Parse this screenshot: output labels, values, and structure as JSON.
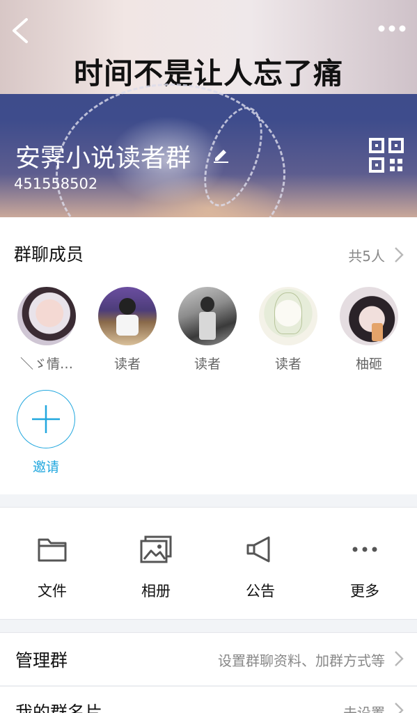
{
  "header": {
    "banner_text": "时间不是让人忘了痛",
    "group_name": "安霁小说读者群",
    "group_id": "451558502"
  },
  "members": {
    "title": "群聊成员",
    "count": "共5人",
    "list": [
      {
        "name": "＼ゞ情…"
      },
      {
        "name": "读者"
      },
      {
        "name": "读者"
      },
      {
        "name": "读者"
      },
      {
        "name": "柚砸"
      }
    ],
    "invite_label": "邀请"
  },
  "actions": [
    {
      "label": "文件",
      "icon": "folder-icon"
    },
    {
      "label": "相册",
      "icon": "album-icon"
    },
    {
      "label": "公告",
      "icon": "megaphone-icon"
    },
    {
      "label": "更多",
      "icon": "more-dots-icon"
    }
  ],
  "settings": [
    {
      "title": "管理群",
      "value": "设置群聊资料、加群方式等"
    },
    {
      "title": "我的群名片",
      "value": "未设置"
    }
  ],
  "colors": {
    "accent": "#21a7de",
    "header_bg": "#3e4c8c"
  }
}
